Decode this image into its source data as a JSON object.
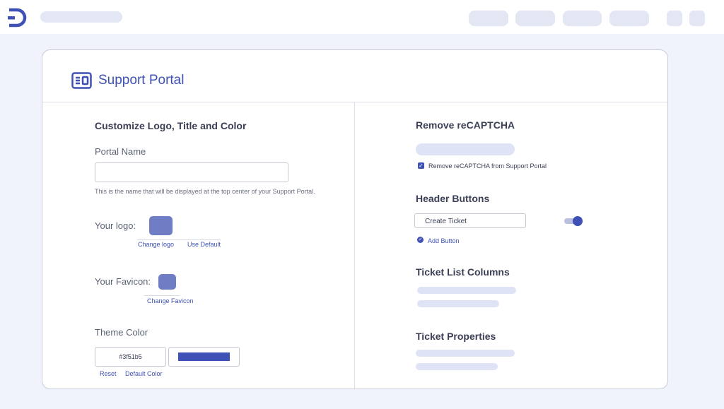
{
  "colors": {
    "accent": "#3f51b5",
    "swatch": "#6f7ec4",
    "placeholder": "#e3e6f3",
    "page_bg": "#f1f3fc"
  },
  "topbar": {
    "logo_icon": "d-logo-icon"
  },
  "header": {
    "icon": "portal-layout-icon",
    "title": "Support Portal"
  },
  "left": {
    "section_title": "Customize Logo, Title and Color",
    "portal_name": {
      "label": "Portal Name",
      "value": "",
      "help": "This is the name that will be displayed at the top center of your Support Portal."
    },
    "logo": {
      "label": "Your logo:",
      "change": "Change logo",
      "use_default": "Use Default"
    },
    "favicon": {
      "label": "Your Favicon:",
      "change": "Change Favicon"
    },
    "theme": {
      "label": "Theme Color",
      "hex": "#3f51b5",
      "hex_display": "#3f51b5",
      "reset": "Reset",
      "default": "Default Color"
    }
  },
  "right": {
    "recaptcha": {
      "title": "Remove reCAPTCHA",
      "checkbox_label": "Remove reCAPTCHA from Support Portal",
      "checked": true
    },
    "header_buttons": {
      "title": "Header Buttons",
      "button_value": "Create Ticket",
      "toggle_on": true,
      "add": "Add Button"
    },
    "ticket_list": {
      "title": "Ticket List Columns"
    },
    "ticket_props": {
      "title": "Ticket Properties"
    }
  }
}
